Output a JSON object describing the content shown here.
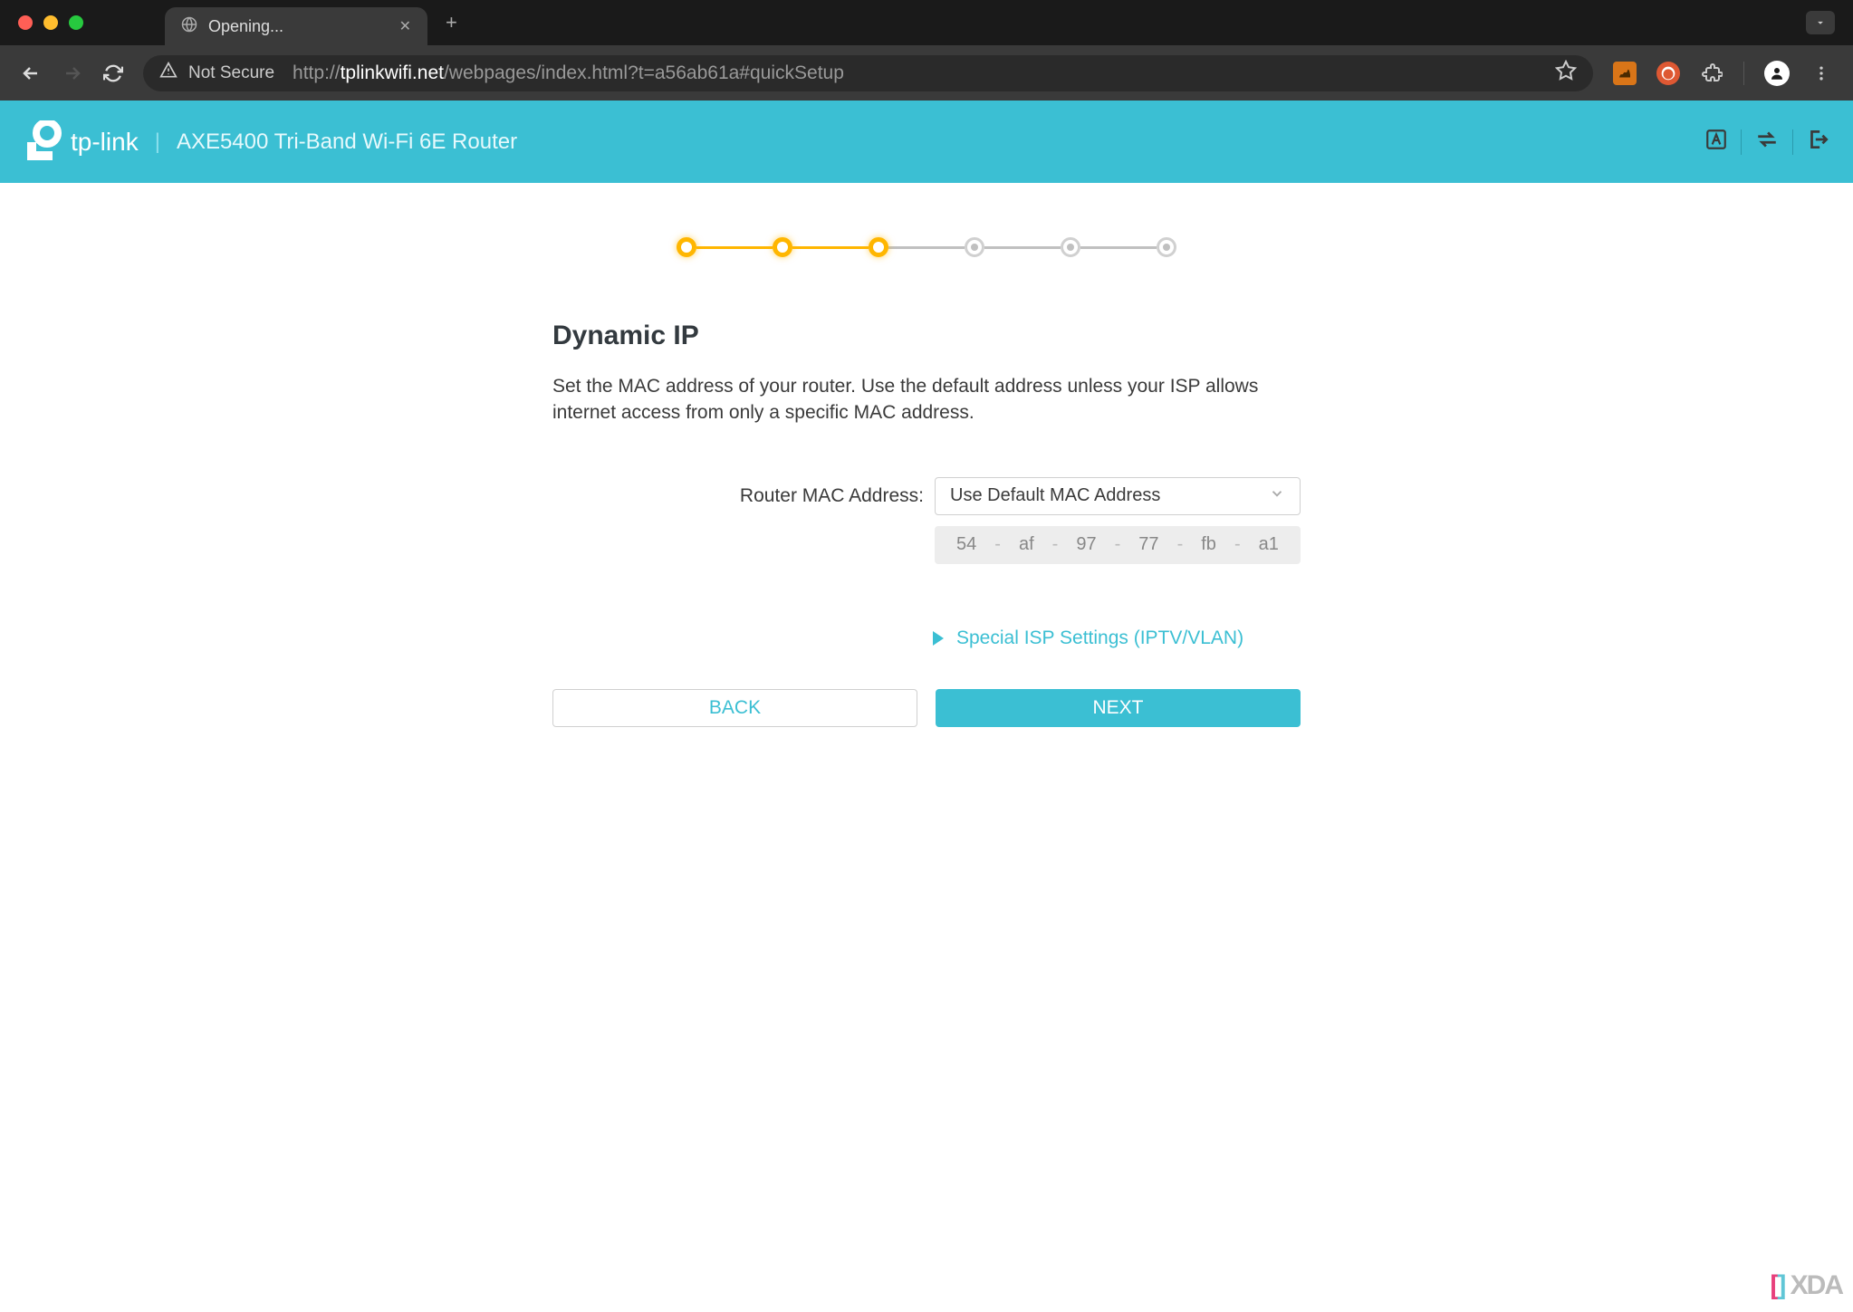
{
  "browser": {
    "tab_title": "Opening...",
    "security_label": "Not Secure",
    "url_prefix": "http://",
    "url_host": "tplinkwifi.net",
    "url_path": "/webpages/index.html?t=a56ab61a#quickSetup"
  },
  "header": {
    "brand": "tp-link",
    "product": "AXE5400 Tri-Band Wi-Fi 6E Router"
  },
  "stepper": {
    "total": 6,
    "active": 3
  },
  "page": {
    "title": "Dynamic IP",
    "description": "Set the MAC address of your router. Use the default address unless your ISP allows internet access from only a specific MAC address.",
    "mac_label": "Router MAC Address:",
    "mac_select_value": "Use Default MAC Address",
    "mac_octets": [
      "54",
      "af",
      "97",
      "77",
      "fb",
      "a1"
    ],
    "expand_label": "Special ISP Settings (IPTV/VLAN)",
    "back_label": "BACK",
    "next_label": "NEXT"
  },
  "watermark": {
    "text": "XDA"
  }
}
